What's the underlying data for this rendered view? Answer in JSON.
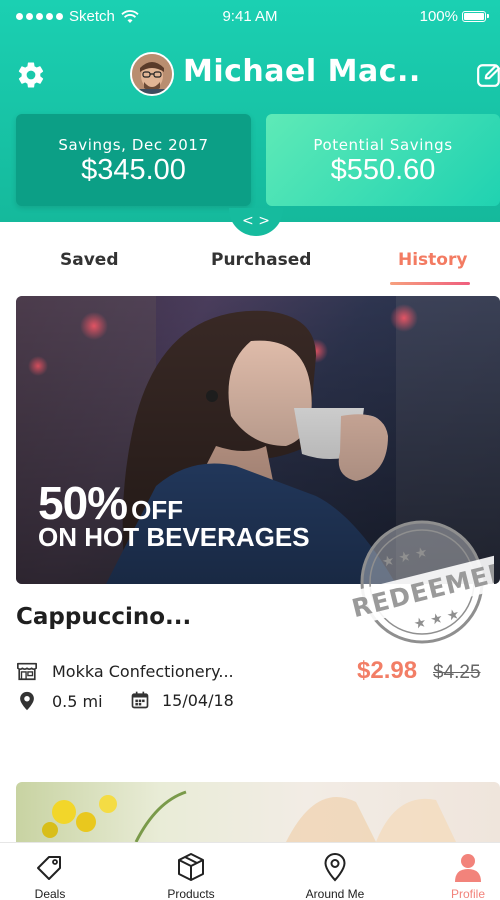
{
  "status_bar": {
    "carrier": "Sketch",
    "time": "9:41 AM",
    "battery": "100%"
  },
  "header": {
    "user_name": "Michael Mac..",
    "savings": {
      "label": "Savings, Dec 2017",
      "value": "$345.00"
    },
    "potential": {
      "label": "Potential Savings",
      "value": "$550.60"
    },
    "pager_arrows": "< >",
    "accent_color": "#1bd0b2"
  },
  "tabs": {
    "items": [
      "Saved",
      "Purchased",
      "History"
    ],
    "active": "History",
    "active_color": "#f37b62"
  },
  "deal": {
    "promo_percent": "50%",
    "promo_off": "OFF",
    "promo_subtitle": "ON HOT BEVERAGES",
    "stamp_text": "REDEEMED",
    "title": "Cappuccino...",
    "store": "Mokka Confectionery...",
    "distance": "0.5 mi",
    "date": "15/04/18",
    "price": "$2.98",
    "old_price": "$4.25",
    "icons": [
      "store-icon",
      "location-pin-icon",
      "calendar-icon"
    ]
  },
  "bottom_nav": {
    "items": [
      {
        "label": "Deals",
        "icon": "tag-icon"
      },
      {
        "label": "Products",
        "icon": "box-icon"
      },
      {
        "label": "Around Me",
        "icon": "map-pin-icon"
      },
      {
        "label": "Profile",
        "icon": "person-icon"
      }
    ],
    "active": "Profile",
    "active_color": "#f2837b"
  }
}
